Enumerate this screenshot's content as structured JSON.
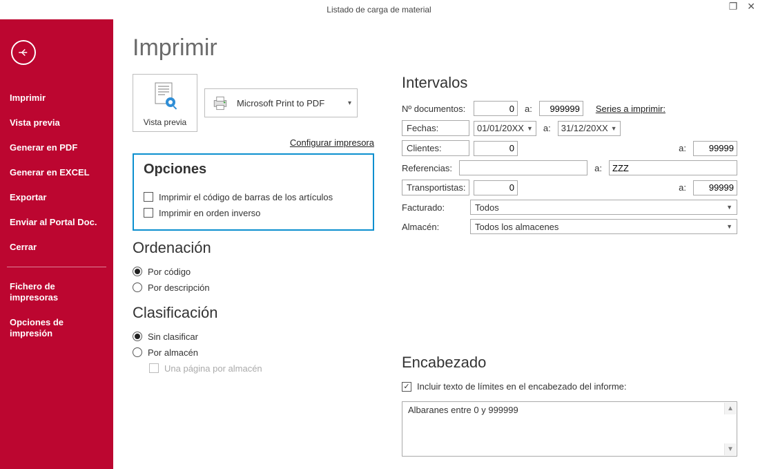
{
  "window": {
    "title": "Listado de carga de material"
  },
  "sidebar": {
    "items": [
      {
        "label": "Imprimir",
        "bold": true
      },
      {
        "label": "Vista previa",
        "bold": true
      },
      {
        "label": "Generar en PDF",
        "bold": true
      },
      {
        "label": "Generar en EXCEL",
        "bold": true
      },
      {
        "label": "Exportar",
        "bold": true
      },
      {
        "label": "Enviar al Portal Doc.",
        "bold": true
      },
      {
        "label": "Cerrar",
        "bold": true
      }
    ],
    "secondary": [
      {
        "label": "Fichero de impresoras",
        "bold": true
      },
      {
        "label": "Opciones de impresión",
        "bold": true
      }
    ]
  },
  "page_title": "Imprimir",
  "print": {
    "preview_label": "Vista previa",
    "printer_name": "Microsoft Print to PDF",
    "config_link": "Configurar impresora"
  },
  "options": {
    "title": "Opciones",
    "barcode_label": "Imprimir el código de barras de los artículos",
    "barcode_checked": false,
    "reverse_label": "Imprimir en orden inverso",
    "reverse_checked": false
  },
  "ordering": {
    "title": "Ordenación",
    "by_code_label": "Por código",
    "by_desc_label": "Por descripción",
    "selected": "code"
  },
  "classification": {
    "title": "Clasificación",
    "none_label": "Sin clasificar",
    "by_warehouse_label": "Por almacén",
    "page_per_wh_label": "Una página por almacén",
    "selected": "none",
    "page_per_wh_checked": false
  },
  "intervals": {
    "title": "Intervalos",
    "doc_label": "Nº documentos:",
    "doc_from": "0",
    "doc_to": "999999",
    "series_link": "Series a imprimir:",
    "dates_btn": "Fechas:",
    "date_from": "01/01/20XX",
    "date_to": "31/12/20XX",
    "clients_btn": "Clientes:",
    "clients_from": "0",
    "clients_to": "99999",
    "refs_label": "Referencias:",
    "refs_from": "",
    "refs_to": "ZZZ",
    "carriers_btn": "Transportistas:",
    "carriers_from": "0",
    "carriers_to": "99999",
    "invoiced_label": "Facturado:",
    "invoiced_value": "Todos",
    "warehouse_label": "Almacén:",
    "warehouse_value": "Todos los almacenes",
    "sep_a": "a:"
  },
  "header_section": {
    "title": "Encabezado",
    "include_label": "Incluir texto de límites en el encabezado del informe:",
    "include_checked": true,
    "text": "Albaranes entre 0 y 999999"
  }
}
